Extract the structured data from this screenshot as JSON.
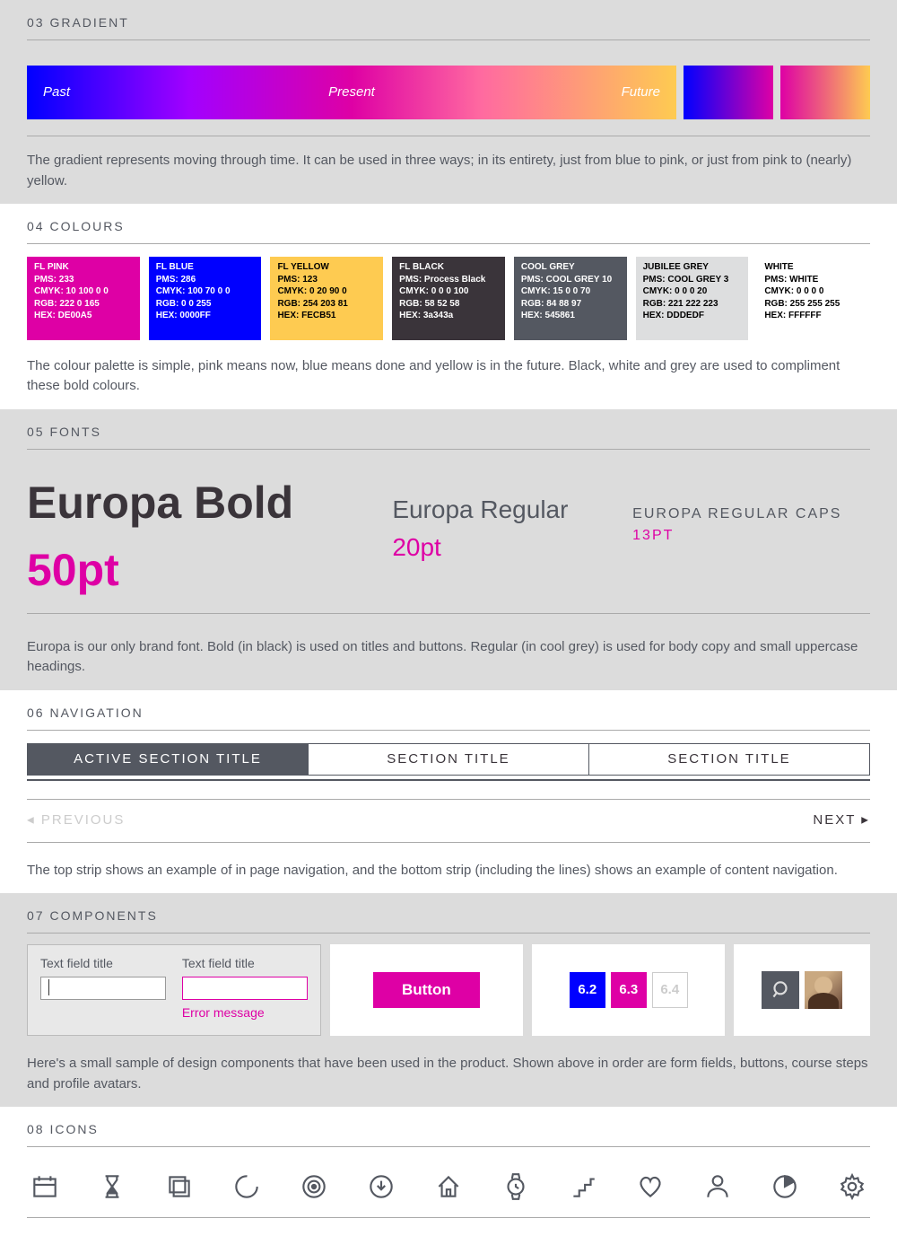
{
  "gradient": {
    "section_no": "03",
    "section_title": "GRADIENT",
    "labels": {
      "past": "Past",
      "present": "Present",
      "future": "Future"
    },
    "desc": "The gradient represents moving through time.  It can be used in three ways; in its entirety, just from blue to pink, or just from pink to (nearly) yellow."
  },
  "colours": {
    "section_no": "04",
    "section_title": "COLOURS",
    "swatches": [
      {
        "name": "FL PINK",
        "pms": "PMS: 233",
        "cmyk": "CMYK: 10 100 0 0",
        "rgb": "RGB: 222 0 165",
        "hex": "HEX: DE00A5",
        "bg": "#DE00A5",
        "light": false
      },
      {
        "name": "FL BLUE",
        "pms": "PMS: 286",
        "cmyk": "CMYK: 100 70 0 0",
        "rgb": "RGB: 0 0 255",
        "hex": "HEX: 0000FF",
        "bg": "#0000FF",
        "light": false
      },
      {
        "name": "FL YELLOW",
        "pms": "PMS: 123",
        "cmyk": "CMYK: 0 20 90 0",
        "rgb": "RGB: 254 203 81",
        "hex": "HEX: FECB51",
        "bg": "#FECB51",
        "light": true
      },
      {
        "name": "FL BLACK",
        "pms": "PMS: Process Black",
        "cmyk": "CMYK: 0 0 0 100",
        "rgb": "RGB: 58 52 58",
        "hex": "HEX: 3a343a",
        "bg": "#3a343a",
        "light": false
      },
      {
        "name": "COOL GREY",
        "pms": "PMS: COOL GREY 10",
        "cmyk": "CMYK: 15 0 0 70",
        "rgb": "RGB: 84 88 97",
        "hex": "HEX: 545861",
        "bg": "#545861",
        "light": false
      },
      {
        "name": "JUBILEE GREY",
        "pms": "PMS: COOL GREY 3",
        "cmyk": "CMYK: 0 0 0 20",
        "rgb": "RGB: 221 222 223",
        "hex": "HEX: DDDEDF",
        "bg": "#DDDEDF",
        "light": true
      },
      {
        "name": "WHITE",
        "pms": "PMS: WHITE",
        "cmyk": "CMYK: 0 0 0 0",
        "rgb": "RGB: 255 255 255",
        "hex": "HEX: FFFFFF",
        "bg": "#FFFFFF",
        "light": true
      }
    ],
    "desc": "The colour palette is simple, pink means now, blue means done and yellow is in the future.  Black, white and grey are used to compliment these bold colours."
  },
  "fonts": {
    "section_no": "05",
    "section_title": "FONTS",
    "bold_name": "Europa Bold",
    "bold_size": "50pt",
    "reg_name": "Europa Regular",
    "reg_size": "20pt",
    "caps_name": "EUROPA REGULAR CAPS",
    "caps_size": "13PT",
    "desc": "Europa is our only brand font.  Bold (in black) is used on titles and buttons.  Regular (in cool grey) is used for body copy and small uppercase headings."
  },
  "navigation": {
    "section_no": "06",
    "section_title": "NAVIGATION",
    "tabs": [
      {
        "label": "ACTIVE SECTION TITLE",
        "active": true
      },
      {
        "label": "SECTION TITLE",
        "active": false
      },
      {
        "label": "SECTION TITLE",
        "active": false
      }
    ],
    "prev": "PREVIOUS",
    "next": "NEXT",
    "desc": "The top strip shows an example of in page navigation, and the bottom strip (including the lines) shows an example of content navigation."
  },
  "components": {
    "section_no": "07",
    "section_title": "COMPONENTS",
    "field1_label": "Text field title",
    "field2_label": "Text field title",
    "error_msg": "Error message",
    "button_label": "Button",
    "steps": [
      {
        "label": "6.2",
        "state": "done"
      },
      {
        "label": "6.3",
        "state": "now"
      },
      {
        "label": "6.4",
        "state": "future"
      }
    ],
    "desc": "Here's a small sample of design components that have been used in the product. Shown above in order are form fields, buttons, course steps and profile avatars."
  },
  "icons": {
    "section_no": "08",
    "section_title": "ICONS",
    "list": [
      "calendar-icon",
      "hourglass-icon",
      "layers-icon",
      "loading-icon",
      "target-icon",
      "download-icon",
      "home-icon",
      "watch-icon",
      "steps-icon",
      "heart-icon",
      "person-icon",
      "pie-icon",
      "gear-icon"
    ]
  }
}
